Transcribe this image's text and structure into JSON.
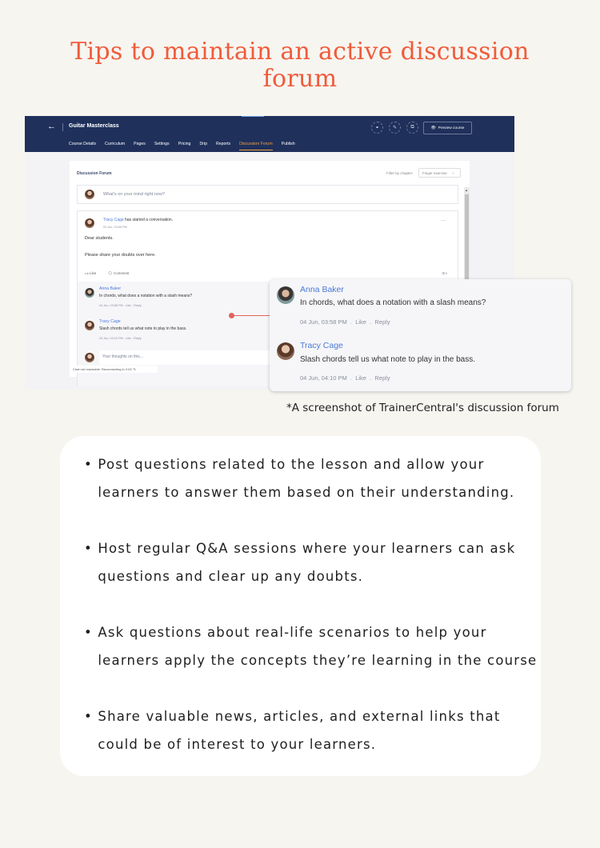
{
  "title": {
    "line1": "Tips to maintain an active discussion",
    "line2": "forum",
    "color": "#f05b3a"
  },
  "app": {
    "back_icon": "←",
    "course_title": "Guitar Masterclass",
    "tabs": [
      {
        "label": "Course Details",
        "active": false
      },
      {
        "label": "Curriculum",
        "active": false
      },
      {
        "label": "Pages",
        "active": false
      },
      {
        "label": "Settings",
        "active": false
      },
      {
        "label": "Pricing",
        "active": false
      },
      {
        "label": "Drip",
        "active": false
      },
      {
        "label": "Reports",
        "active": false
      },
      {
        "label": "Discussion Forum",
        "active": true
      },
      {
        "label": "Publish",
        "active": false
      }
    ],
    "toolbar_icons": [
      "link-icon",
      "edit-icon",
      "copy-icon"
    ],
    "preview_label": "Preview course",
    "panel_title": "Discussion Forum",
    "filter_label": "Filter by chapter:",
    "filter_value": "Finger exercise",
    "composer_placeholder": "What's on your mind right now?",
    "post": {
      "author": "Tracy Cage",
      "action": " has started a conversation.",
      "time": "04 Jun, 03:55 PM",
      "more": "···",
      "body_line1": "Dear students.",
      "body_line2": "Please share your doubts over here.",
      "like_label": "Like",
      "comment_label": "Comment",
      "views": "5"
    },
    "comments": [
      {
        "author": "Anna Baker",
        "text": "In chords, what does a notation with a slash means?",
        "time": "04 Jun, 03:58 PM",
        "like": "Like",
        "reply": "Reply"
      },
      {
        "author": "Tracy Cage",
        "text": "Slash chords tell us what note to play in the bass.",
        "time": "04 Jun, 04:10 PM",
        "like": "Like",
        "reply": "Reply"
      }
    ],
    "reply_placeholder": "Your thoughts on this...",
    "status_text": "Chat not reachable. Reconnecting in 2:03",
    "accent": "#f2a23a",
    "nav_bg": "#1f305b",
    "link_color": "#4a78d8"
  },
  "caption": "*A screenshot of TrainerCentral's discussion forum",
  "tips": [
    {
      "line1": "Post questions related to the lesson and allow your",
      "line2": "learners to answer them based on their understanding."
    },
    {
      "line1": "Host regular Q&A sessions where your learners can ask",
      "line2": "questions and clear up any doubts."
    },
    {
      "line1": "Ask questions about real-life scenarios to help your",
      "line2": "learners apply the concepts they’re learning in the course"
    },
    {
      "line1": "Share valuable news, articles, and external links that",
      "line2": "could be of interest to your learners."
    }
  ]
}
